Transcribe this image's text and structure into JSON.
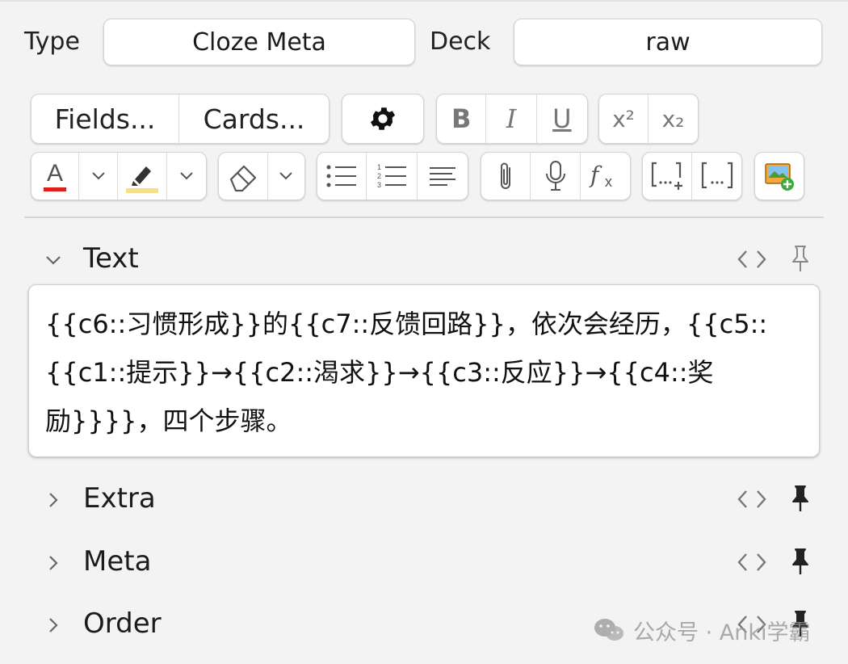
{
  "header": {
    "type_label": "Type",
    "type_value": "Cloze Meta",
    "deck_label": "Deck",
    "deck_value": "raw"
  },
  "toolbar": {
    "fields_button": "Fields...",
    "cards_button": "Cards...",
    "bold": "B",
    "italic": "I",
    "underline": "U",
    "superscript": "x²",
    "subscript": "x₂",
    "icons": [
      "gear-icon",
      "text-color-icon",
      "highlight-icon",
      "eraser-icon",
      "bullet-list-icon",
      "numbered-list-icon",
      "align-icon",
      "paperclip-icon",
      "microphone-icon",
      "formula-icon",
      "cloze-new-icon",
      "cloze-icon",
      "image-occlusion-icon"
    ],
    "text_color": "#e0201b",
    "highlight_color": "#f7e08a"
  },
  "fields": [
    {
      "name": "Text",
      "expanded": true
    },
    {
      "name": "Extra",
      "expanded": false
    },
    {
      "name": "Meta",
      "expanded": false
    },
    {
      "name": "Order",
      "expanded": false
    }
  ],
  "editor": {
    "content": "{{c6::习惯形成}}的{{c7::反馈回路}}，依次会经历，{{c5::{{c1::提示}}→{{c2::渴求}}→{{c3::反应}}→{{c4::奖励}}}}，四个步骤。"
  },
  "watermark": {
    "text": "公众号 · Anki学霸"
  }
}
